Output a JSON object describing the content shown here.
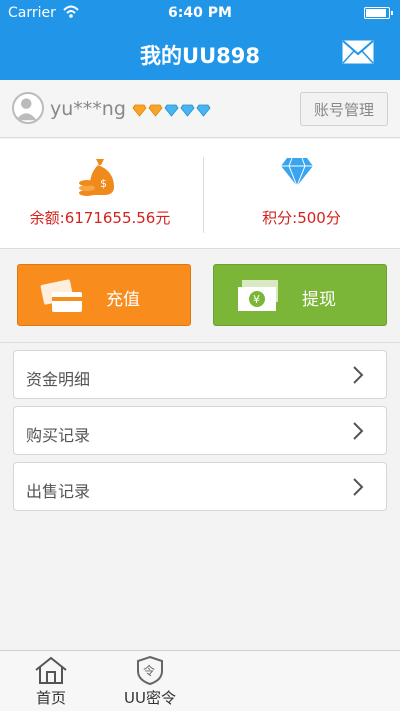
{
  "status_bar": {
    "carrier": "Carrier",
    "time": "6:40 PM"
  },
  "header": {
    "title": "我的UU898",
    "mail_icon": "mail-icon"
  },
  "user": {
    "username": "yu***ng",
    "gems": [
      "orange",
      "orange",
      "blue",
      "blue",
      "blue"
    ],
    "account_button": "账号管理"
  },
  "balance": {
    "label": "余额:6171655.56元",
    "points": "积分:500分"
  },
  "actions": {
    "recharge": "充值",
    "withdraw": "提现"
  },
  "menu": {
    "items": [
      "资金明细",
      "购买记录",
      "出售记录"
    ]
  },
  "tabbar": {
    "home": "首页",
    "uu_token": "UU密令"
  },
  "colors": {
    "header": "#2196e8",
    "recharge": "#f88c1d",
    "withdraw": "#7cb639",
    "money_text": "#d4221e"
  }
}
